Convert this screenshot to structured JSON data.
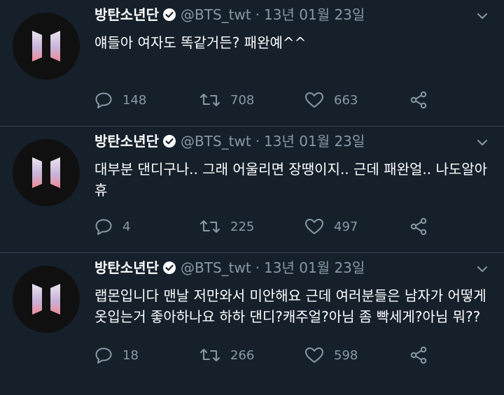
{
  "account": {
    "name": "방탄소년단",
    "handle": "@BTS_twt",
    "avatar_icon": "bts-logo-icon",
    "verified_icon": "verified-badge-icon"
  },
  "colors": {
    "background": "#15202b",
    "divider": "#38444d",
    "muted": "#8899a6",
    "text": "#ffffff"
  },
  "tweets": [
    {
      "date": "13년 01월 23일",
      "text": "얘들아 여자도 똑같거든? 패완예^^",
      "replies": "148",
      "retweets": "708",
      "likes": "663"
    },
    {
      "date": "13년 01월 23일",
      "text": "대부분 댄디구나.. 그래 어울리면 장땡이지.. 근데 패완얼.. 나도알아\n휴",
      "replies": "4",
      "retweets": "225",
      "likes": "497"
    },
    {
      "date": "13년 01월 23일",
      "text": "랩몬입니다 맨날 저만와서 미안해요 근데 여러분들은 남자가 어떻게\n옷입는거 좋아하나요 하하 댄디?캐주얼?아님 좀 빡세게?아님 뭐??",
      "replies": "18",
      "retweets": "266",
      "likes": "598"
    }
  ],
  "icons": {
    "reply": "reply-icon",
    "retweet": "retweet-icon",
    "like": "heart-icon",
    "share": "share-icon",
    "menu": "chevron-down-icon"
  }
}
